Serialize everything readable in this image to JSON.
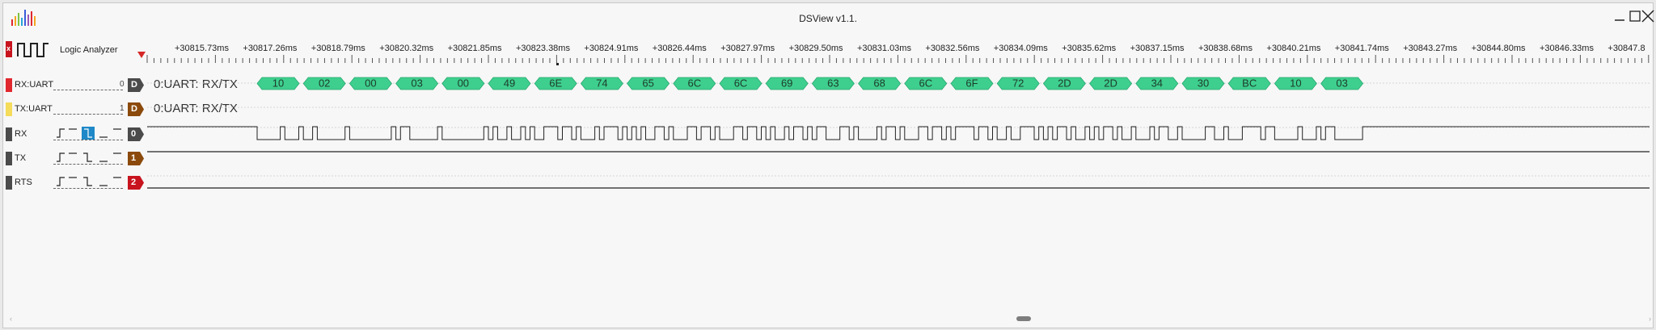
{
  "window": {
    "title": "DSView v1.1."
  },
  "toolbar": {
    "mode_badge": "x",
    "mode_label": "Logic Analyzer"
  },
  "ruler": {
    "ticks": [
      "+30815.73ms",
      "+30817.26ms",
      "+30818.79ms",
      "+30820.32ms",
      "+30821.85ms",
      "+30823.38ms",
      "+30824.91ms",
      "+30826.44ms",
      "+30827.97ms",
      "+30829.50ms",
      "+30831.03ms",
      "+30832.56ms",
      "+30834.09ms",
      "+30835.62ms",
      "+30837.15ms",
      "+30838.68ms",
      "+30840.21ms",
      "+30841.74ms",
      "+30843.27ms",
      "+30844.80ms",
      "+30846.33ms",
      "+30847.8"
    ]
  },
  "channels": [
    {
      "name": "RX:UART",
      "index": "0",
      "tag": "D",
      "color": "#e0282f",
      "tag_color": "#4b4b4b",
      "decode_label": "0:UART: RX/TX"
    },
    {
      "name": "TX:UART",
      "index": "1",
      "tag": "D",
      "color": "#f5dc5a",
      "tag_color": "#8b4a0b",
      "decode_label": "0:UART: RX/TX"
    },
    {
      "name": "RX",
      "index": "",
      "tag": "0",
      "color": "#4b4b4b",
      "tag_color": "#4b4b4b"
    },
    {
      "name": "TX",
      "index": "",
      "tag": "1",
      "color": "#4b4b4b",
      "tag_color": "#8b4a0b"
    },
    {
      "name": "RTS",
      "index": "",
      "tag": "2",
      "color": "#4b4b4b",
      "tag_color": "#c8141e"
    }
  ],
  "decode_bytes": [
    "10",
    "02",
    "00",
    "03",
    "00",
    "49",
    "6E",
    "74",
    "65",
    "6C",
    "6C",
    "69",
    "63",
    "68",
    "6C",
    "6F",
    "72",
    "2D",
    "2D",
    "34",
    "30",
    "BC",
    "10",
    "03"
  ],
  "colors": {
    "decode_fill": "#3ecf8e",
    "trigger_selected": "#1e88c8",
    "trigger_marker": "#d62828"
  },
  "icons": {
    "app": "logic-bars-icon",
    "analyzer": "square-wave-icon",
    "minimize": "minimize-icon",
    "maximize": "maximize-icon",
    "close": "close-icon",
    "trigger": "trigger-marker-icon"
  }
}
